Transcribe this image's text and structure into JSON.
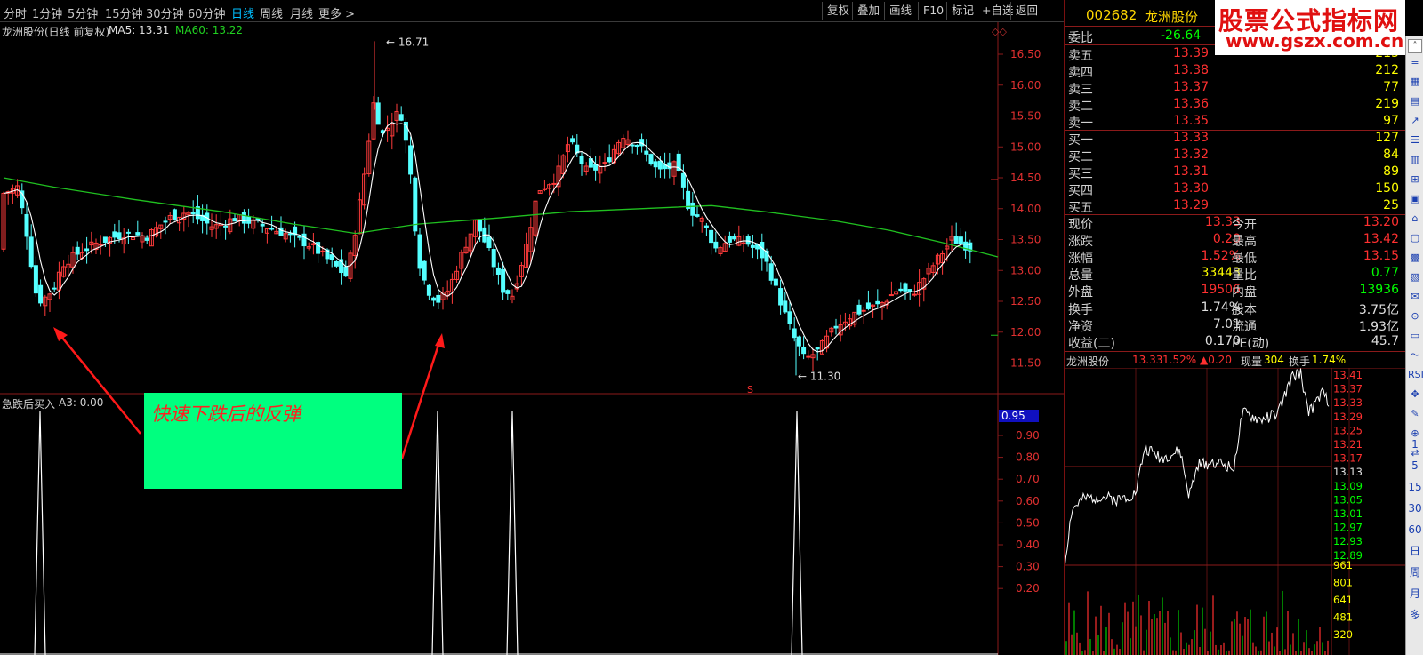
{
  "toolbar": {
    "periods": [
      "分时",
      "1分钟",
      "5分钟",
      "15分钟",
      "30分钟",
      "60分钟",
      "日线",
      "周线",
      "月线",
      "更多 >"
    ],
    "active_index": 6,
    "buttons": [
      "复权",
      "叠加",
      "画线",
      "F10",
      "标记",
      "+自选",
      "返回"
    ]
  },
  "main_header": {
    "title": "龙洲股份(日线 前复权)",
    "ma5": "MA5: 13.31",
    "ma60": "MA60: 13.22"
  },
  "price_axis": [
    "16.50",
    "16.00",
    "15.50",
    "15.00",
    "14.50",
    "14.00",
    "13.50",
    "13.00",
    "12.50",
    "12.00",
    "11.50"
  ],
  "annotations": {
    "high": "16.71",
    "low": "11.30",
    "callout": "快速下跌后的反弹",
    "marker": "S"
  },
  "indicator": {
    "title": "急跌后买入",
    "value": "A3: 0.00",
    "axis": [
      "0.90",
      "0.80",
      "0.70",
      "0.60",
      "0.50",
      "0.40",
      "0.30",
      "0.20"
    ],
    "current": "0.95"
  },
  "chart_data": {
    "type": "candlestick",
    "ylim": [
      11.1,
      16.8
    ],
    "highest": 16.71,
    "lowest": 11.3,
    "signal_spikes_at": [
      45,
      492,
      576,
      896
    ],
    "signal_ylim": [
      0,
      1
    ]
  },
  "quote": {
    "code": "002682",
    "name": "龙洲股份",
    "weibi_label": "委比",
    "weibi_value": "-26.64",
    "asks": [
      {
        "label": "卖五",
        "price": "13.39",
        "vol": "215"
      },
      {
        "label": "卖四",
        "price": "13.38",
        "vol": "212"
      },
      {
        "label": "卖三",
        "price": "13.37",
        "vol": "77"
      },
      {
        "label": "卖二",
        "price": "13.36",
        "vol": "219"
      },
      {
        "label": "卖一",
        "price": "13.35",
        "vol": "97"
      }
    ],
    "bids": [
      {
        "label": "买一",
        "price": "13.33",
        "vol": "127"
      },
      {
        "label": "买二",
        "price": "13.32",
        "vol": "84"
      },
      {
        "label": "买三",
        "price": "13.31",
        "vol": "89"
      },
      {
        "label": "买四",
        "price": "13.30",
        "vol": "150"
      },
      {
        "label": "买五",
        "price": "13.29",
        "vol": "25"
      }
    ],
    "stats": [
      {
        "l1": "现价",
        "v1": "13.33",
        "l2": "今开",
        "v2": "13.20"
      },
      {
        "l1": "涨跌",
        "v1": "0.20",
        "l2": "最高",
        "v2": "13.42"
      },
      {
        "l1": "涨幅",
        "v1": "1.52%",
        "l2": "最低",
        "v2": "13.15"
      },
      {
        "l1": "总量",
        "v1": "33443",
        "l2": "量比",
        "v2": "0.77"
      },
      {
        "l1": "外盘",
        "v1": "19506",
        "l2": "内盘",
        "v2": "13936"
      }
    ],
    "stats2": [
      {
        "l1": "换手",
        "v1": "1.74%",
        "l2": "股本",
        "v2": "3.75亿"
      },
      {
        "l1": "净资",
        "v1": "7.01",
        "l2": "流通",
        "v2": "1.93亿"
      },
      {
        "l1": "收益(二)",
        "v1": "0.170",
        "l2": "PE(动)",
        "v2": "45.7"
      }
    ]
  },
  "intraday": {
    "name": "龙洲股份",
    "price": "13.33",
    "pct": "1.52%",
    "change": "▲0.20",
    "vol_label": "现量",
    "vol": "304",
    "turn_label": "换手",
    "turn": "1.74%",
    "price_axis": [
      "13.41",
      "13.37",
      "13.33",
      "13.29",
      "13.25",
      "13.21",
      "13.17",
      "13.13",
      "13.09",
      "13.05",
      "13.01",
      "12.97",
      "12.93",
      "12.89"
    ],
    "vol_axis": [
      "961",
      "801",
      "641",
      "481",
      "320"
    ]
  },
  "watermark": {
    "line1": "股票公式指标网",
    "line2": "www.gszx.com.cn"
  },
  "side_tools": [
    "1",
    "5",
    "15",
    "30",
    "60",
    "日",
    "周",
    "月",
    "多"
  ],
  "colors": {
    "up": "#ff3b3b",
    "down": "#54ffff",
    "ma5": "#ffffff",
    "ma60": "#20c020",
    "yellow": "#ffff00",
    "green": "#00ff00",
    "red": "#ff3030",
    "callout_bg": "#00ff7f",
    "callout_text": "#ff2020"
  }
}
